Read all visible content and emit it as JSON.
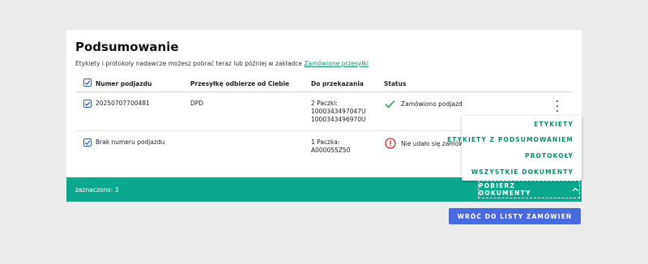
{
  "summary": {
    "title": "Podsumowanie",
    "subtitle_text": "Etykiety i protokoły nadawcze możesz pobrać teraz lub później w zakładce ",
    "subtitle_link": "Zamówione przesyłki"
  },
  "table": {
    "headers": [
      "Numer podjazdu",
      "Przesyłkę odbierze od Ciebie",
      "Do przekazania",
      "Status"
    ],
    "header_checked": true,
    "rows": [
      {
        "checked": true,
        "pickup_number": "20250707700481",
        "carrier": "DPD",
        "handover_count": "2 Paczki:",
        "handover_ids": [
          "1000343497047U",
          "1000343496970U"
        ],
        "status_text": "Zamówiono podjazd",
        "status_icon": "check-icon",
        "status_color": "#2a9d4b"
      },
      {
        "checked": true,
        "pickup_number": "Brak numeru podjazdu",
        "carrier": "",
        "handover_count": "1 Paczka:",
        "handover_ids": [
          "A000055Z50"
        ],
        "status_text": "Nie udało się zamówić",
        "status_icon": "error-icon",
        "status_color": "#d9262c"
      }
    ]
  },
  "footer": {
    "selected_text": "zaznaczono: 3",
    "download_button": "POBIERZ DOKUMENTY",
    "bar_color": "#0aa88c"
  },
  "download_menu": {
    "items": [
      "ETYKIETY",
      "ETYKIETY Z PODSUMOWANIEM",
      "PROTOKOŁY",
      "WSZYSTKIE DOKUMENTY"
    ]
  },
  "back_button": "WRÓĆ DO LISTY ZAMÓWIEŃ",
  "colors": {
    "accent_blue": "#4a6be0",
    "accent_green": "#0aa88c",
    "link_green": "#1a8a72"
  }
}
